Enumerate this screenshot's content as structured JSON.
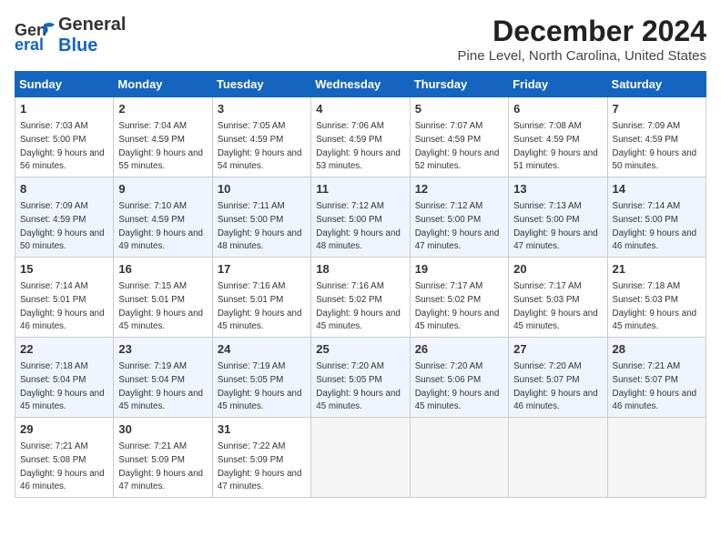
{
  "logo": {
    "line1": "General",
    "line2": "Blue"
  },
  "title": "December 2024",
  "location": "Pine Level, North Carolina, United States",
  "weekdays": [
    "Sunday",
    "Monday",
    "Tuesday",
    "Wednesday",
    "Thursday",
    "Friday",
    "Saturday"
  ],
  "weeks": [
    [
      {
        "day": "1",
        "sunrise": "Sunrise: 7:03 AM",
        "sunset": "Sunset: 5:00 PM",
        "daylight": "Daylight: 9 hours and 56 minutes."
      },
      {
        "day": "2",
        "sunrise": "Sunrise: 7:04 AM",
        "sunset": "Sunset: 4:59 PM",
        "daylight": "Daylight: 9 hours and 55 minutes."
      },
      {
        "day": "3",
        "sunrise": "Sunrise: 7:05 AM",
        "sunset": "Sunset: 4:59 PM",
        "daylight": "Daylight: 9 hours and 54 minutes."
      },
      {
        "day": "4",
        "sunrise": "Sunrise: 7:06 AM",
        "sunset": "Sunset: 4:59 PM",
        "daylight": "Daylight: 9 hours and 53 minutes."
      },
      {
        "day": "5",
        "sunrise": "Sunrise: 7:07 AM",
        "sunset": "Sunset: 4:59 PM",
        "daylight": "Daylight: 9 hours and 52 minutes."
      },
      {
        "day": "6",
        "sunrise": "Sunrise: 7:08 AM",
        "sunset": "Sunset: 4:59 PM",
        "daylight": "Daylight: 9 hours and 51 minutes."
      },
      {
        "day": "7",
        "sunrise": "Sunrise: 7:09 AM",
        "sunset": "Sunset: 4:59 PM",
        "daylight": "Daylight: 9 hours and 50 minutes."
      }
    ],
    [
      {
        "day": "8",
        "sunrise": "Sunrise: 7:09 AM",
        "sunset": "Sunset: 4:59 PM",
        "daylight": "Daylight: 9 hours and 50 minutes."
      },
      {
        "day": "9",
        "sunrise": "Sunrise: 7:10 AM",
        "sunset": "Sunset: 4:59 PM",
        "daylight": "Daylight: 9 hours and 49 minutes."
      },
      {
        "day": "10",
        "sunrise": "Sunrise: 7:11 AM",
        "sunset": "Sunset: 5:00 PM",
        "daylight": "Daylight: 9 hours and 48 minutes."
      },
      {
        "day": "11",
        "sunrise": "Sunrise: 7:12 AM",
        "sunset": "Sunset: 5:00 PM",
        "daylight": "Daylight: 9 hours and 48 minutes."
      },
      {
        "day": "12",
        "sunrise": "Sunrise: 7:12 AM",
        "sunset": "Sunset: 5:00 PM",
        "daylight": "Daylight: 9 hours and 47 minutes."
      },
      {
        "day": "13",
        "sunrise": "Sunrise: 7:13 AM",
        "sunset": "Sunset: 5:00 PM",
        "daylight": "Daylight: 9 hours and 47 minutes."
      },
      {
        "day": "14",
        "sunrise": "Sunrise: 7:14 AM",
        "sunset": "Sunset: 5:00 PM",
        "daylight": "Daylight: 9 hours and 46 minutes."
      }
    ],
    [
      {
        "day": "15",
        "sunrise": "Sunrise: 7:14 AM",
        "sunset": "Sunset: 5:01 PM",
        "daylight": "Daylight: 9 hours and 46 minutes."
      },
      {
        "day": "16",
        "sunrise": "Sunrise: 7:15 AM",
        "sunset": "Sunset: 5:01 PM",
        "daylight": "Daylight: 9 hours and 45 minutes."
      },
      {
        "day": "17",
        "sunrise": "Sunrise: 7:16 AM",
        "sunset": "Sunset: 5:01 PM",
        "daylight": "Daylight: 9 hours and 45 minutes."
      },
      {
        "day": "18",
        "sunrise": "Sunrise: 7:16 AM",
        "sunset": "Sunset: 5:02 PM",
        "daylight": "Daylight: 9 hours and 45 minutes."
      },
      {
        "day": "19",
        "sunrise": "Sunrise: 7:17 AM",
        "sunset": "Sunset: 5:02 PM",
        "daylight": "Daylight: 9 hours and 45 minutes."
      },
      {
        "day": "20",
        "sunrise": "Sunrise: 7:17 AM",
        "sunset": "Sunset: 5:03 PM",
        "daylight": "Daylight: 9 hours and 45 minutes."
      },
      {
        "day": "21",
        "sunrise": "Sunrise: 7:18 AM",
        "sunset": "Sunset: 5:03 PM",
        "daylight": "Daylight: 9 hours and 45 minutes."
      }
    ],
    [
      {
        "day": "22",
        "sunrise": "Sunrise: 7:18 AM",
        "sunset": "Sunset: 5:04 PM",
        "daylight": "Daylight: 9 hours and 45 minutes."
      },
      {
        "day": "23",
        "sunrise": "Sunrise: 7:19 AM",
        "sunset": "Sunset: 5:04 PM",
        "daylight": "Daylight: 9 hours and 45 minutes."
      },
      {
        "day": "24",
        "sunrise": "Sunrise: 7:19 AM",
        "sunset": "Sunset: 5:05 PM",
        "daylight": "Daylight: 9 hours and 45 minutes."
      },
      {
        "day": "25",
        "sunrise": "Sunrise: 7:20 AM",
        "sunset": "Sunset: 5:05 PM",
        "daylight": "Daylight: 9 hours and 45 minutes."
      },
      {
        "day": "26",
        "sunrise": "Sunrise: 7:20 AM",
        "sunset": "Sunset: 5:06 PM",
        "daylight": "Daylight: 9 hours and 45 minutes."
      },
      {
        "day": "27",
        "sunrise": "Sunrise: 7:20 AM",
        "sunset": "Sunset: 5:07 PM",
        "daylight": "Daylight: 9 hours and 46 minutes."
      },
      {
        "day": "28",
        "sunrise": "Sunrise: 7:21 AM",
        "sunset": "Sunset: 5:07 PM",
        "daylight": "Daylight: 9 hours and 46 minutes."
      }
    ],
    [
      {
        "day": "29",
        "sunrise": "Sunrise: 7:21 AM",
        "sunset": "Sunset: 5:08 PM",
        "daylight": "Daylight: 9 hours and 46 minutes."
      },
      {
        "day": "30",
        "sunrise": "Sunrise: 7:21 AM",
        "sunset": "Sunset: 5:09 PM",
        "daylight": "Daylight: 9 hours and 47 minutes."
      },
      {
        "day": "31",
        "sunrise": "Sunrise: 7:22 AM",
        "sunset": "Sunset: 5:09 PM",
        "daylight": "Daylight: 9 hours and 47 minutes."
      },
      null,
      null,
      null,
      null
    ]
  ]
}
